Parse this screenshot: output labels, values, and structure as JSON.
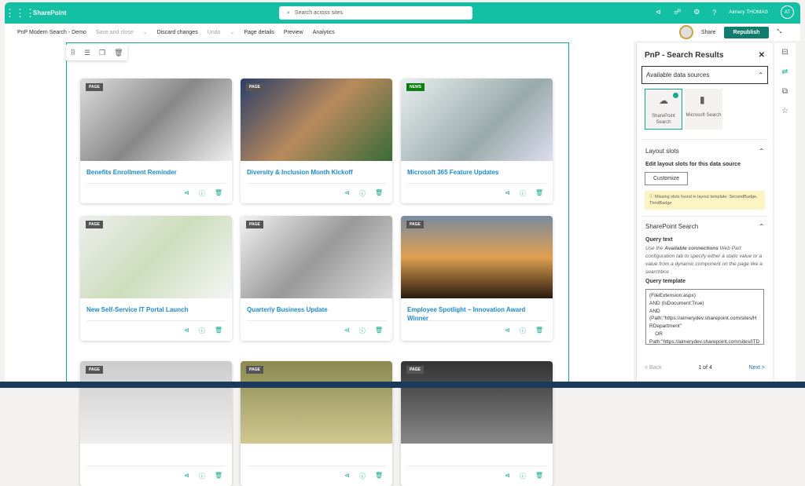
{
  "suite": {
    "app": "SharePoint",
    "search_placeholder": "Search across sites",
    "user": "Aimery THOMAS",
    "initials": "AT"
  },
  "cmd": {
    "page": "PnP Modern Search - Demo",
    "save": "Save and close",
    "discard": "Discard changes",
    "undo": "Undo",
    "details": "Page details",
    "preview": "Preview",
    "analytics": "Analytics",
    "share": "Share",
    "republish": "Republish"
  },
  "cards": [
    {
      "badge": "PAGE",
      "title": "Benefits Enrollment Reminder"
    },
    {
      "badge": "PAGE",
      "title": "Diversity & Inclusion Month Kickoff"
    },
    {
      "badge": "NEWS",
      "title": "Microsoft 365 Feature Updates"
    },
    {
      "badge": "PAGE",
      "title": "New Self-Service IT Portal Launch"
    },
    {
      "badge": "PAGE",
      "title": "Quarterly Business Update"
    },
    {
      "badge": "PAGE",
      "title": "Employee Spotlight – Innovation Award Winner"
    },
    {
      "badge": "PAGE",
      "title": ""
    },
    {
      "badge": "PAGE",
      "title": ""
    },
    {
      "badge": "PAGE",
      "title": ""
    }
  ],
  "panel": {
    "title": "PnP - Search Results",
    "ds_head": "Available data sources",
    "ds": [
      "SharePoint Search",
      "Microsoft Search"
    ],
    "slots_head": "Layout slots",
    "slots_label": "Edit layout slots for this data source",
    "customize": "Customize",
    "warning": "Missing slots found in layout template: SecondBadge, ThirdBadge",
    "sp_head": "SharePoint Search",
    "qt_label": "Query text",
    "qt_pre": "Use the ",
    "qt_bold": "Available connections",
    "qt_post": " Web Part configuration tab to specify either a static value or a value from a dynamic component on the page like a searchbox",
    "template_label": "Query template",
    "template": "(FileExtension:aspx)\nAND (IsDocument:True)\nAND\n(Path:\"https://aimerydev.sharepoint.com/sites/HRDepartment\"\n    OR\nPath:\"https://aimerydev.sharepoint.com/sites/ITDepartment\"",
    "back": "< Back",
    "page": "1 of 4",
    "next": "Next >"
  }
}
